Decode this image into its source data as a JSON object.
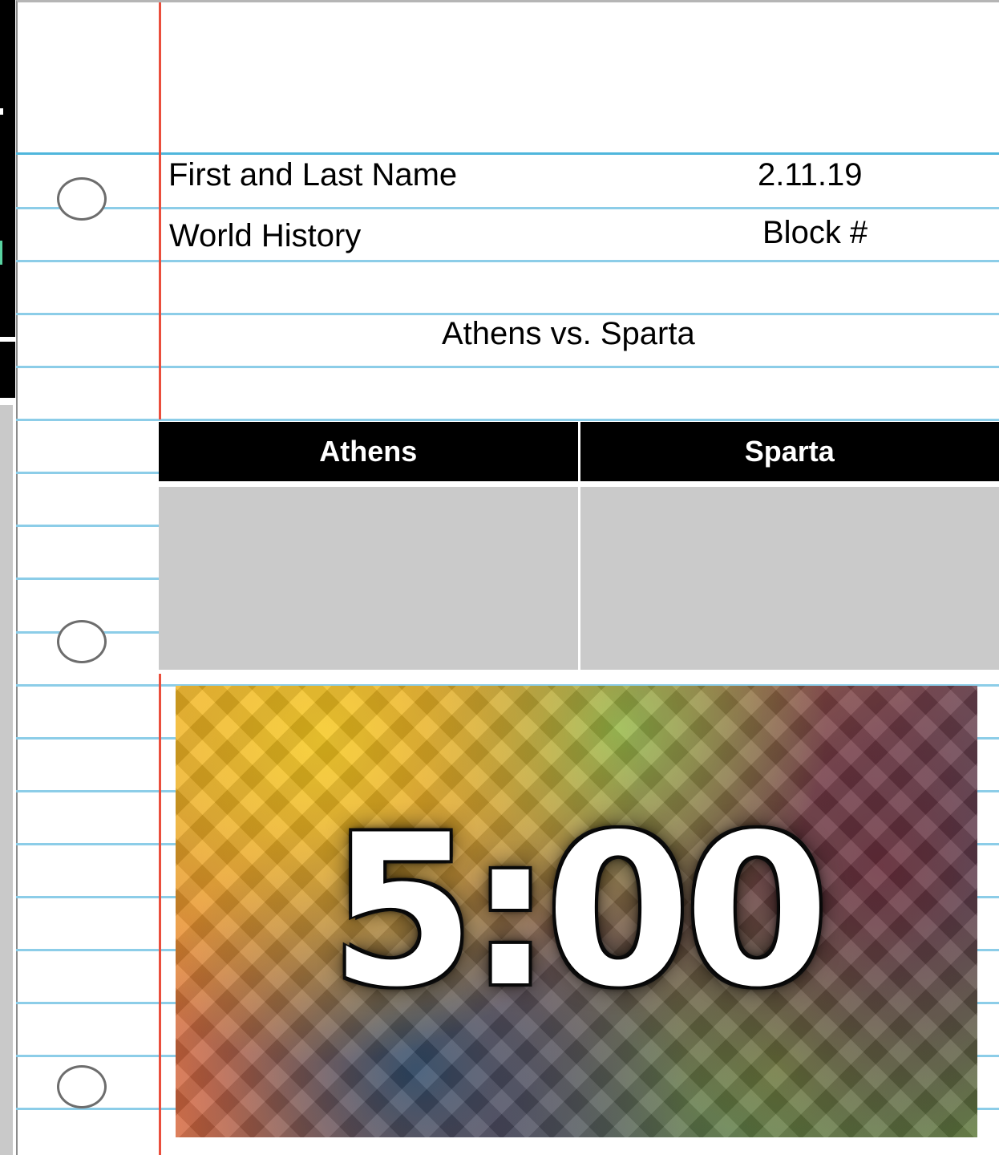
{
  "header": {
    "name": "First and Last Name",
    "date": "2.11.19",
    "subject": "World History",
    "block": "Block #"
  },
  "title": "Athens vs. Sparta",
  "table": {
    "columns": [
      "Athens",
      "Sparta"
    ]
  },
  "timer": {
    "display": "5:00"
  },
  "colors": {
    "rule_line": "#8ccde8",
    "margin_line": "#ea4e3c",
    "table_header": "#000000",
    "table_cell": "#cacaca"
  }
}
